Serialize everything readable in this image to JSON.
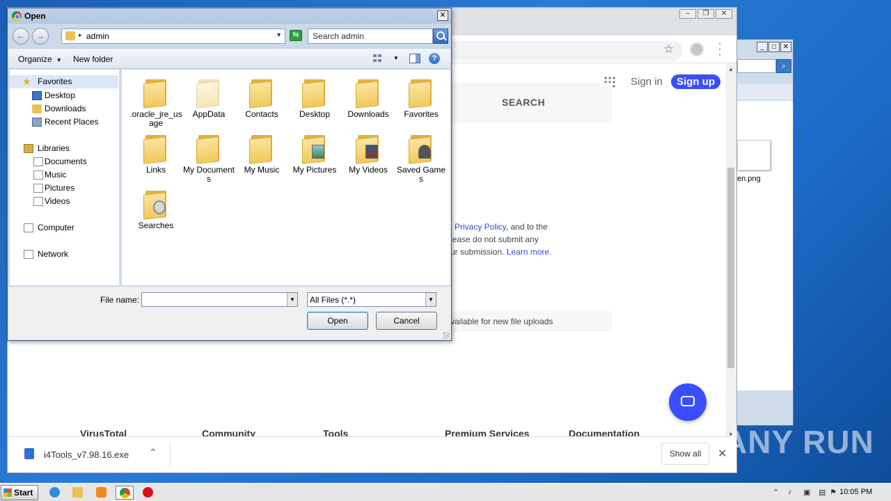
{
  "background_explorer": {
    "file_label": "en.png"
  },
  "chrome": {
    "page": {
      "sign_in": "Sign in",
      "sign_up": "Sign up",
      "search_tab": "SEARCH",
      "policy_prefix": "l ",
      "policy_link": "Privacy Policy",
      "policy_line1_suffix": ", and to the",
      "policy_line2": "lease do not submit any",
      "policy_line3": "ur submission. ",
      "learn_more": "Learn more.",
      "availability": "vailable for new file uploads",
      "footer": [
        "VirusTotal",
        "Community",
        "Tools",
        "Premium Services",
        "Documentation"
      ]
    },
    "download_bar": {
      "filename": "i4Tools_v7.98.16.exe",
      "show_all": "Show all"
    }
  },
  "dialog": {
    "title": "Open",
    "address_path": "admin",
    "search_placeholder": "Search admin",
    "toolbar": {
      "organize": "Organize",
      "new_folder": "New folder"
    },
    "nav": {
      "favorites": "Favorites",
      "desktop": "Desktop",
      "downloads": "Downloads",
      "recent_places": "Recent Places",
      "libraries": "Libraries",
      "documents": "Documents",
      "music": "Music",
      "pictures": "Pictures",
      "videos": "Videos",
      "computer": "Computer",
      "network": "Network"
    },
    "files": [
      ".oracle_jre_usage",
      "AppData",
      "Contacts",
      "Desktop",
      "Downloads",
      "Favorites",
      "Links",
      "My Documents",
      "My Music",
      "My Pictures",
      "My Videos",
      "Saved Games",
      "Searches"
    ],
    "file_name_label": "File name:",
    "file_name_value": "",
    "file_type": "All Files (*.*)",
    "open_button": "Open",
    "cancel_button": "Cancel"
  },
  "taskbar": {
    "start": "Start",
    "clock": "10:05 PM"
  },
  "watermark": "ANY RUN"
}
